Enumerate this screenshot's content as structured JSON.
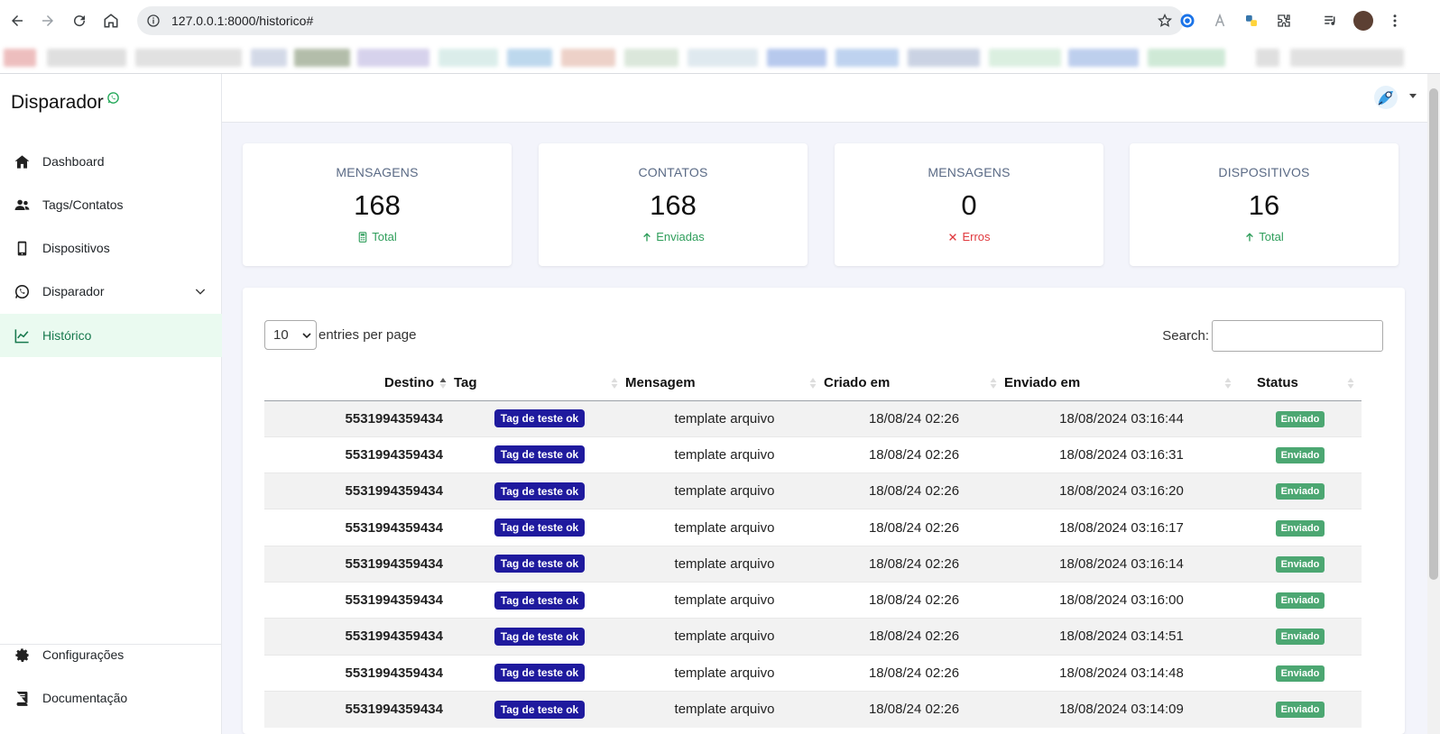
{
  "browser": {
    "url": "127.0.0.1:8000/historico#"
  },
  "sidebar": {
    "brand": "Disparador",
    "items": [
      {
        "label": "Dashboard",
        "icon": "home-icon"
      },
      {
        "label": "Tags/Contatos",
        "icon": "users-icon"
      },
      {
        "label": "Dispositivos",
        "icon": "mobile-icon"
      },
      {
        "label": "Disparador",
        "icon": "whatsapp-icon"
      },
      {
        "label": "Histórico",
        "icon": "chart-line-icon"
      }
    ],
    "bottom_items": [
      {
        "label": "Configurações",
        "icon": "gear-icon"
      },
      {
        "label": "Documentação",
        "icon": "book-icon"
      }
    ]
  },
  "stats": [
    {
      "title": "MENSAGENS",
      "value": "168",
      "sub": "Total",
      "sub_color": "#2f9e5b"
    },
    {
      "title": "CONTATOS",
      "value": "168",
      "sub": "Enviadas",
      "sub_color": "#2f9e5b"
    },
    {
      "title": "MENSAGENS",
      "value": "0",
      "sub": "Erros",
      "sub_color": "#e0393e"
    },
    {
      "title": "DISPOSITIVOS",
      "value": "16",
      "sub": "Total",
      "sub_color": "#2f9e5b"
    }
  ],
  "table": {
    "entries_value": "10",
    "entries_label": "entries per page",
    "search_label": "Search:",
    "columns": [
      "Destino",
      "Tag",
      "Mensagem",
      "Criado em",
      "Enviado em",
      "Status"
    ],
    "rows": [
      {
        "destino": "5531994359434",
        "tag": "Tag de teste ok",
        "mensagem": "template arquivo",
        "criado": "18/08/24 02:26",
        "enviado": "18/08/2024 03:16:44",
        "status": "Enviado"
      },
      {
        "destino": "5531994359434",
        "tag": "Tag de teste ok",
        "mensagem": "template arquivo",
        "criado": "18/08/24 02:26",
        "enviado": "18/08/2024 03:16:31",
        "status": "Enviado"
      },
      {
        "destino": "5531994359434",
        "tag": "Tag de teste ok",
        "mensagem": "template arquivo",
        "criado": "18/08/24 02:26",
        "enviado": "18/08/2024 03:16:20",
        "status": "Enviado"
      },
      {
        "destino": "5531994359434",
        "tag": "Tag de teste ok",
        "mensagem": "template arquivo",
        "criado": "18/08/24 02:26",
        "enviado": "18/08/2024 03:16:17",
        "status": "Enviado"
      },
      {
        "destino": "5531994359434",
        "tag": "Tag de teste ok",
        "mensagem": "template arquivo",
        "criado": "18/08/24 02:26",
        "enviado": "18/08/2024 03:16:14",
        "status": "Enviado"
      },
      {
        "destino": "5531994359434",
        "tag": "Tag de teste ok",
        "mensagem": "template arquivo",
        "criado": "18/08/24 02:26",
        "enviado": "18/08/2024 03:16:00",
        "status": "Enviado"
      },
      {
        "destino": "5531994359434",
        "tag": "Tag de teste ok",
        "mensagem": "template arquivo",
        "criado": "18/08/24 02:26",
        "enviado": "18/08/2024 03:14:51",
        "status": "Enviado"
      },
      {
        "destino": "5531994359434",
        "tag": "Tag de teste ok",
        "mensagem": "template arquivo",
        "criado": "18/08/24 02:26",
        "enviado": "18/08/2024 03:14:48",
        "status": "Enviado"
      },
      {
        "destino": "5531994359434",
        "tag": "Tag de teste ok",
        "mensagem": "template arquivo",
        "criado": "18/08/24 02:26",
        "enviado": "18/08/2024 03:14:09",
        "status": "Enviado"
      }
    ]
  }
}
